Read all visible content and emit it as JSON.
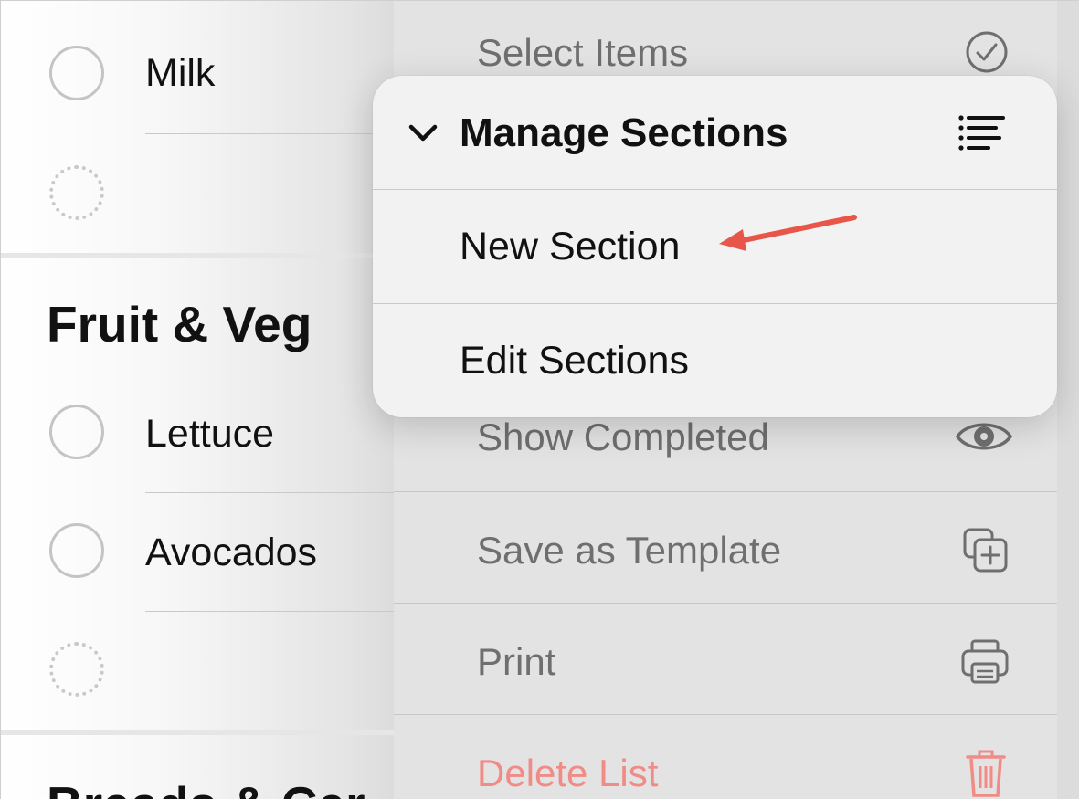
{
  "list": {
    "items": [
      {
        "label": "Milk"
      },
      {
        "label": ""
      },
      {
        "label": "Lettuce"
      },
      {
        "label": "Avocados"
      },
      {
        "label": ""
      }
    ],
    "sections": [
      {
        "title": "Fruit & Veg"
      },
      {
        "title": "Breads & Cer"
      }
    ]
  },
  "menu": {
    "items": [
      {
        "label": "Select Items",
        "icon": "checkmark-circle-icon"
      },
      {
        "label": "Show Completed",
        "icon": "eye-icon"
      },
      {
        "label": "Save as Template",
        "icon": "duplicate-plus-icon"
      },
      {
        "label": "Print",
        "icon": "printer-icon"
      },
      {
        "label": "Delete List",
        "icon": "trash-icon"
      }
    ],
    "destructive_color": "#f08b85"
  },
  "submenu": {
    "header": "Manage Sections",
    "header_icon": "list-lines-icon",
    "items": [
      {
        "label": "New Section"
      },
      {
        "label": "Edit Sections"
      }
    ]
  },
  "annotation": {
    "color": "#e8564a",
    "target": "New Section"
  }
}
